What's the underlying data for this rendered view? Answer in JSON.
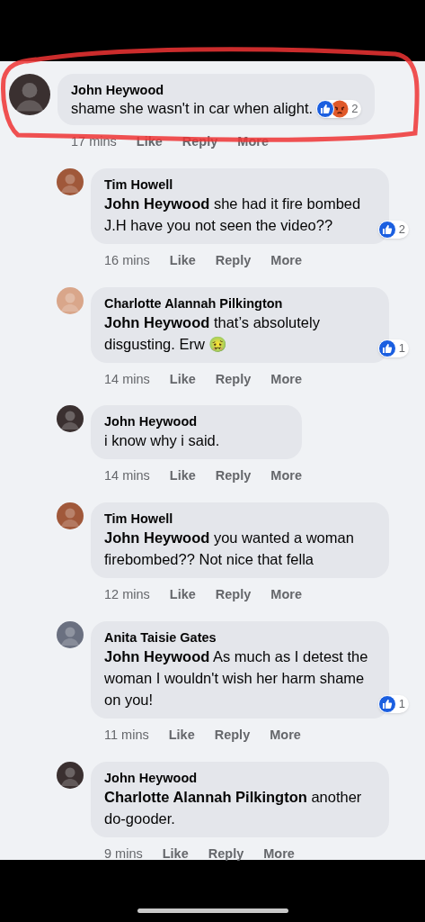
{
  "comments": [
    {
      "kind": "top",
      "author": "John Heywood",
      "text": "shame she wasn't in car when alight.",
      "time": "17 mins",
      "actions": [
        "Like",
        "Reply",
        "More"
      ],
      "reactions": [
        {
          "kind": "like"
        },
        {
          "kind": "angry"
        }
      ],
      "reaction_count": "2",
      "color": "#3a3030"
    },
    {
      "kind": "reply",
      "author": "Tim Howell",
      "text": "**John Heywood** she had it fire bombed J.H have you not seen the video??",
      "time": "16 mins",
      "actions": [
        "Like",
        "Reply",
        "More"
      ],
      "reactions": [
        {
          "kind": "like"
        }
      ],
      "reaction_count": "2",
      "color": "#a0583a"
    },
    {
      "kind": "reply",
      "author": "Charlotte Alannah Pilkington",
      "text": "**John Heywood** that’s absolutely disgusting. Erw 🤢",
      "time": "14 mins",
      "actions": [
        "Like",
        "Reply",
        "More"
      ],
      "reactions": [
        {
          "kind": "like"
        }
      ],
      "reaction_count": "1",
      "color": "#d9a68a"
    },
    {
      "kind": "reply",
      "author": "John Heywood",
      "text": "i know why i said.",
      "time": "14 mins",
      "actions": [
        "Like",
        "Reply",
        "More"
      ],
      "color": "#3a3030"
    },
    {
      "kind": "reply",
      "author": "Tim Howell",
      "text": "**John Heywood** you wanted a woman firebombed?? Not nice that fella",
      "time": "12 mins",
      "actions": [
        "Like",
        "Reply",
        "More"
      ],
      "color": "#a0583a"
    },
    {
      "kind": "reply",
      "author": "Anita Taisie Gates",
      "text": "**John Heywood** As much as I detest the woman I wouldn't wish her harm shame on you!",
      "time": "11 mins",
      "actions": [
        "Like",
        "Reply",
        "More"
      ],
      "reactions": [
        {
          "kind": "like"
        }
      ],
      "reaction_count": "1",
      "color": "#6a7080"
    },
    {
      "kind": "reply",
      "author": "John Heywood",
      "text": "**Charlotte Alannah Pilkington** another do-gooder.",
      "time": "9 mins",
      "actions": [
        "Like",
        "Reply",
        "More"
      ],
      "color": "#3a3030"
    }
  ]
}
